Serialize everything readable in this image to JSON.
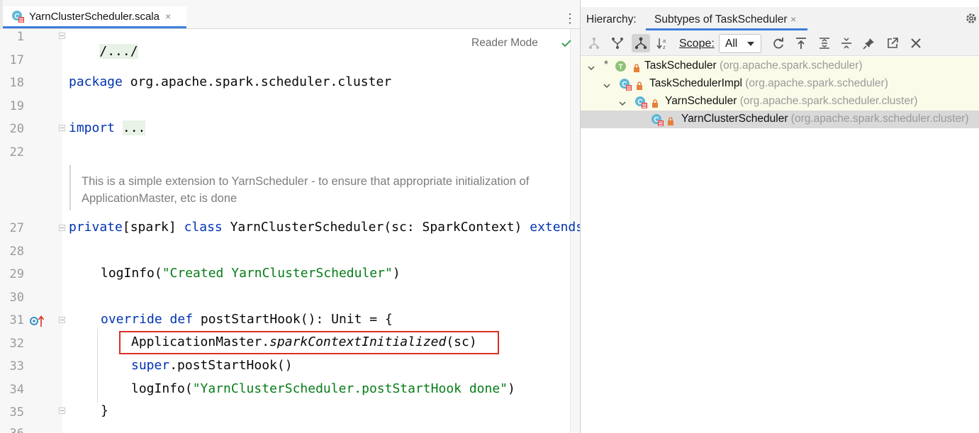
{
  "editor": {
    "tab": {
      "filename": "YarnClusterScheduler.scala",
      "close": "×"
    },
    "reader_mode": "Reader Mode",
    "lines": {
      "l1": "1",
      "l17": "17",
      "l18": "18",
      "l19": "19",
      "l20": "20",
      "l22": "22",
      "l27": "27",
      "l28": "28",
      "l29": "29",
      "l30": "30",
      "l31": "31",
      "l32": "32",
      "l33": "33",
      "l34": "34",
      "l35": "35",
      "l36": "36"
    },
    "code": {
      "header_fold": "/.../",
      "pkg_kw": "package",
      "pkg_name": " org.apache.spark.scheduler.cluster",
      "import_kw": "import",
      "import_fold": "...",
      "doc_line1": "This is a simple extension to YarnScheduler - to ensure that appropriate initialization of",
      "doc_line2": "ApplicationMaster, etc is done",
      "class_private": "private",
      "class_mod": "[spark] ",
      "class_kw": "class",
      "class_rest": " YarnClusterScheduler(sc: SparkContext) ",
      "class_extends": "extends",
      "loginfo1_call": "logInfo(",
      "loginfo1_str": "\"Created YarnClusterScheduler\"",
      "loginfo1_end": ")",
      "override_kw": "override def",
      "override_rest": " postStartHook(): Unit = {",
      "am_obj": "ApplicationMaster.",
      "am_method": "sparkContextInitialized",
      "am_args": "(sc)",
      "super_kw": "super",
      "super_rest": ".postStartHook()",
      "loginfo2_call": "logInfo(",
      "loginfo2_str": "\"YarnClusterScheduler.postStartHook done\"",
      "loginfo2_end": ")",
      "close_brace": "}"
    }
  },
  "hierarchy": {
    "title": "Hierarchy:",
    "tab_label": "Subtypes of TaskScheduler",
    "tab_close": "×",
    "scope_label": "Scope:",
    "scope_value": "All",
    "tree": [
      {
        "name": "TaskScheduler",
        "pkg": "(org.apache.spark.scheduler)",
        "marker": "*",
        "badge": "T"
      },
      {
        "name": "TaskSchedulerImpl",
        "pkg": "(org.apache.spark.scheduler)"
      },
      {
        "name": "YarnScheduler",
        "pkg": "(org.apache.spark.scheduler.cluster)"
      },
      {
        "name": "YarnClusterScheduler",
        "pkg": "(org.apache.spark.scheduler.cluster)"
      }
    ]
  },
  "colors": {
    "keyword": "#0033b3",
    "string": "#067d17",
    "highlight_box": "#d93025",
    "accent": "#3d7edb"
  }
}
